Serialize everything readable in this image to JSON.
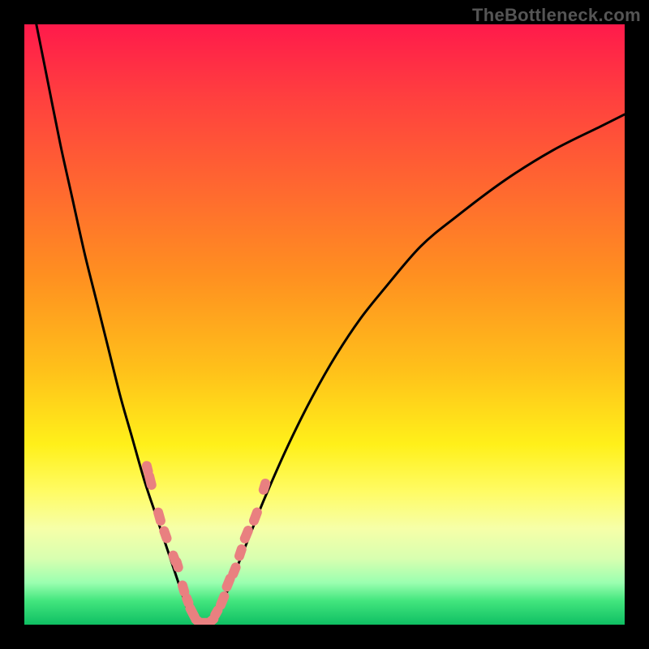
{
  "brand": {
    "watermark": "TheBottleneck.com"
  },
  "chart_data": {
    "type": "line",
    "title": "",
    "xlabel": "",
    "ylabel": "",
    "xlim": [
      0,
      100
    ],
    "ylim": [
      0,
      100
    ],
    "grid": false,
    "legend": false,
    "series": [
      {
        "name": "left-curve",
        "x": [
          2,
          4,
          6,
          8,
          10,
          12,
          14,
          16,
          18,
          20,
          22,
          24,
          26,
          27,
          28,
          29
        ],
        "y": [
          100,
          90,
          80,
          71,
          62,
          54,
          46,
          38,
          31,
          24,
          18,
          12,
          6,
          3,
          1,
          0
        ]
      },
      {
        "name": "right-curve",
        "x": [
          31,
          32,
          34,
          36,
          38,
          40,
          44,
          48,
          52,
          56,
          60,
          66,
          72,
          80,
          88,
          96,
          100
        ],
        "y": [
          0,
          2,
          6,
          11,
          16,
          21,
          30,
          38,
          45,
          51,
          56,
          63,
          68,
          74,
          79,
          83,
          85
        ]
      }
    ],
    "points": {
      "name": "data-markers",
      "note": "scatter overlay along both curves, salmon pill markers",
      "x": [
        20.5,
        21,
        22.5,
        23.5,
        25,
        25.5,
        26.5,
        27.2,
        28,
        29,
        30,
        31,
        32,
        33,
        34,
        35,
        36,
        37,
        38.5,
        40
      ],
      "y": [
        26,
        24,
        18,
        15,
        11,
        10,
        6,
        4,
        2,
        0.5,
        0.3,
        0.5,
        2,
        4,
        7,
        9,
        12,
        15,
        18,
        23
      ]
    },
    "colors": {
      "curve": "#000000",
      "marker": "#e98080",
      "heatmap_top": "#ff1a4b",
      "heatmap_bottom": "#0fbf63"
    }
  }
}
